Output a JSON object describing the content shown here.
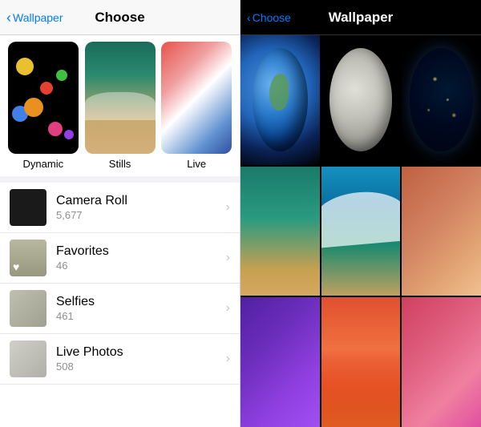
{
  "leftPanel": {
    "navBack": "Wallpaper",
    "navTitle": "Choose",
    "categories": [
      {
        "id": "dynamic",
        "label": "Dynamic"
      },
      {
        "id": "stills",
        "label": "Stills"
      },
      {
        "id": "live",
        "label": "Live"
      }
    ],
    "listItems": [
      {
        "id": "camera-roll",
        "name": "Camera Roll",
        "count": "5,677"
      },
      {
        "id": "favorites",
        "name": "Favorites",
        "count": "46"
      },
      {
        "id": "selfies",
        "name": "Selfies",
        "count": "461"
      },
      {
        "id": "live-photos",
        "name": "Live Photos",
        "count": "508"
      }
    ]
  },
  "rightPanel": {
    "navBack": "Choose",
    "navTitle": "Wallpaper"
  }
}
